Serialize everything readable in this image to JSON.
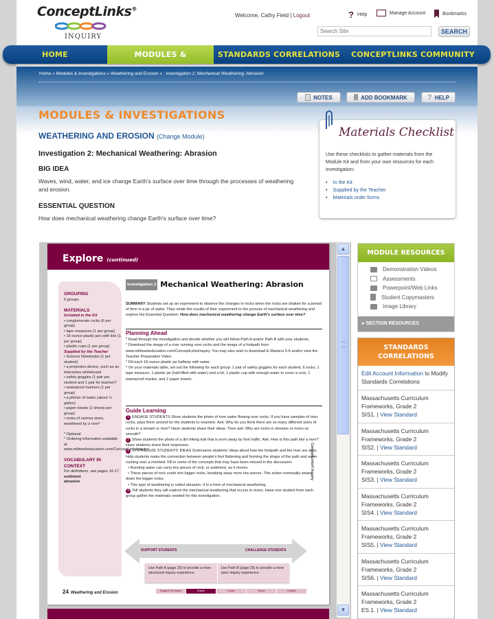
{
  "header": {
    "logo_text": "ConceptLinks",
    "logo_reg": "®",
    "logo_sub": "INQUIRY",
    "welcome": "Welcome, Cathy Field |",
    "logout": "Logout",
    "help": "Help",
    "manage_account": "Manage Account",
    "bookmarks": "Bookmarks",
    "search_placeholder": "Search Site",
    "search_button": "SEARCH"
  },
  "nav": {
    "items": [
      {
        "label": "HOME",
        "active": false
      },
      {
        "label": "MODULES & INVESTIGATIONS",
        "active": true
      },
      {
        "label": "STANDARDS CORRELATIONS",
        "active": false
      },
      {
        "label": "CONCEPTLINKS COMMUNITY",
        "active": false
      }
    ]
  },
  "breadcrumb": "Home » Modules & Investigations » Weathering and Erosion » : Investigation 2: Mechanical Weathering: Abrasion",
  "toolbar": {
    "notes": "NOTES",
    "add_bookmark": "ADD BOOKMARK",
    "help": "HELP"
  },
  "main": {
    "section_title": "MODULES & INVESTIGATIONS",
    "module_title": "WEATHERING AND EROSION",
    "change_module": "(Change Module)",
    "investigation_title": "Investigation 2: Mechanical Weathering: Abrasion",
    "big_idea_heading": "BIG IDEA",
    "big_idea_text": "Waves, wind, water, and ice change Earth's surface over time through the processes of weathering and erosion.",
    "essential_question_heading": "ESSENTIAL QUESTION",
    "essential_question_text": "How does mechanical weathering change Earth's surface over time?"
  },
  "checklist": {
    "title": "Materials Checklist",
    "description": "Use these checklists to gather materials from the Module Kit and from your own resources for each investigation:",
    "links": [
      "In the Kit",
      "Supplied by the Teacher",
      "Materials order forms"
    ]
  },
  "document": {
    "header": "Explore",
    "header_sub": "(continued)",
    "sidebar": {
      "grouping_h": "GROUPING",
      "grouping": "6 groups",
      "materials_h": "MATERIALS",
      "kit_h": "Included in the Kit",
      "kit_items": [
        "conglomerate rocks (6 per group)",
        "tape measures (1 per group)",
        "16-ounce plastic jars with lids (1 per group)",
        "plastic cups (1 per group)"
      ],
      "teacher_h": "Supplied by the Teacher",
      "teacher_items": [
        "Science Notebooks (1 per student)",
        "a projection device, such as an interactive whiteboard",
        "safety goggles (1 pair per student and 1 pair for teacher)*",
        "waterproof markers (1 per group)",
        "a pitcher of water (about ½ gallon)",
        "paper towels (2 sheets per group)",
        "rocks of various sizes, weathered by a river*"
      ],
      "notes": [
        "* Optional",
        "* Ordering information available at www.millmarkeducation.com/ConceptLinksInquiry."
      ],
      "vocab_h": "VOCABULARY IN CONTEXT",
      "vocab_sub": "For definitions, see pages 16-17.",
      "vocab": [
        "sediment",
        "abrasion"
      ]
    },
    "inv_tag": "Investigation 2",
    "title": "Mechanical Weathering: Abrasion",
    "summary_label": "SUMMARY",
    "summary": "Students set up an experiment to observe the changes in rocks when the rocks are shaken for a period of time in a jar of water. They relate the results of their experiment to the process of mechanical weathering and explore the Essential Question:",
    "summary_q": "How does mechanical weathering change Earth's surface over time?",
    "planning_h": "Planning Ahead",
    "planning": [
      "Read through the investigation and decide whether you will follow Path A and/or Path B with your students.",
      "Download the image of a river running over rocks and the image of a footpath from www.millmarkeducation.com/ConceptLinksInquiry. You may also wish to download E-Masters 5-6 and/or view the Teacher Preparation Video.",
      "Fill each 16-ounce plastic jar halfway with water.",
      "On your materials table, set out the following for each group: 1 pair of safety goggles for each student, 6 rocks, 1 tape measure, 1 plastic jar (half-filled with water) and a lid, 1 plastic cup with enough water to cover a rock, 1 waterproof marker, and 2 paper towels."
    ],
    "guide_h": "Guide Learning",
    "steps": [
      "ENGAGE STUDENTS Show students the photo of river water flowing over rocks. If you have samples of river rocks, pass them around for the students to examine. Ask: Why do you think there are so many different sizes of rocks in a stream or river? Have students share their ideas. Then ask: Why are rocks in streams or rivers so smooth?",
      "Show students the photo of a dirt hiking trail that is worn away by foot traffic. Ask: How is this path like a river? Have students share their responses.",
      "SYNTHESIZE STUDENTS' IDEAS Summarize students' ideas about how the footpath and the river are alike. Help students make the connection between people's feet flattening and forming the shape of the path and water rushing over a riverbed. Fill in some of the concepts that may have been missed in the discussion:",
      "Tell students they will explore the mechanical weathering that occurs in rivers. Have one student from each group gather the materials needed for this investigation."
    ],
    "bullets": [
      "Running water can carry tiny pieces of rock, or sediment, as it moves.",
      "These pieces of rock crash into bigger rocks, breaking away more tiny pieces. This action eventually wears down the bigger rocks.",
      "This type of weathering is called abrasion. It is a form of mechanical weathering."
    ],
    "support_label": "SUPPORT STUDENTS",
    "challenge_label": "CHALLENGE STUDENTS",
    "path_a": "Use Path A (page 25) to provide a more structured inquiry experience.",
    "path_b": "Use Path B (page 25) to provide a more open inquiry experience.",
    "page_num": "24",
    "page_title": "Weathering and Erosion",
    "vertical_text": "ConceptLinks® Inquiry",
    "phases": [
      {
        "label": "Engage & Pre-Assess",
        "active": false
      },
      {
        "label": "Explore",
        "active": true
      },
      {
        "label": "Explain",
        "active": false
      },
      {
        "label": "Extend",
        "active": false
      },
      {
        "label": "Evaluate",
        "active": false
      }
    ]
  },
  "resources": {
    "title": "MODULE RESOURCES",
    "items": [
      {
        "icon": "video-icon",
        "label": "Demonstration Videos"
      },
      {
        "icon": "assessment-icon",
        "label": "Assessments"
      },
      {
        "icon": "presentation-icon",
        "label": "Powerpoint/Web Links"
      },
      {
        "icon": "copymaster-icon",
        "label": "Student Copymasters"
      },
      {
        "icon": "camera-icon",
        "label": "Image Library"
      }
    ],
    "section_resources": "▸ SECTION RESOURCES"
  },
  "standards": {
    "title_line1": "STANDARDS",
    "title_line2": "CORRELATIONS",
    "edit_link": "Edit Account Information",
    "edit_suffix": " to Modify Standards Correlations",
    "view_label": "View Standard",
    "items": [
      {
        "framework": "Massachusetts Curriculum Frameworks, Grade 2",
        "code": "SIS1. |"
      },
      {
        "framework": "Massachusetts Curriculum Frameworks, Grade 2",
        "code": "SIS2. |"
      },
      {
        "framework": "Massachusetts Curriculum Frameworks, Grade 2",
        "code": "SIS3. |"
      },
      {
        "framework": "Massachusetts Curriculum Frameworks, Grade 2",
        "code": "SIS4. |"
      },
      {
        "framework": "Massachusetts Curriculum Frameworks, Grade 2",
        "code": "SIS5. |"
      },
      {
        "framework": "Massachusetts Curriculum Frameworks, Grade 2",
        "code": "SIS6. |"
      },
      {
        "framework": "Massachusetts Curriculum Frameworks, Grade 2",
        "code": "ES.1. |"
      }
    ]
  }
}
